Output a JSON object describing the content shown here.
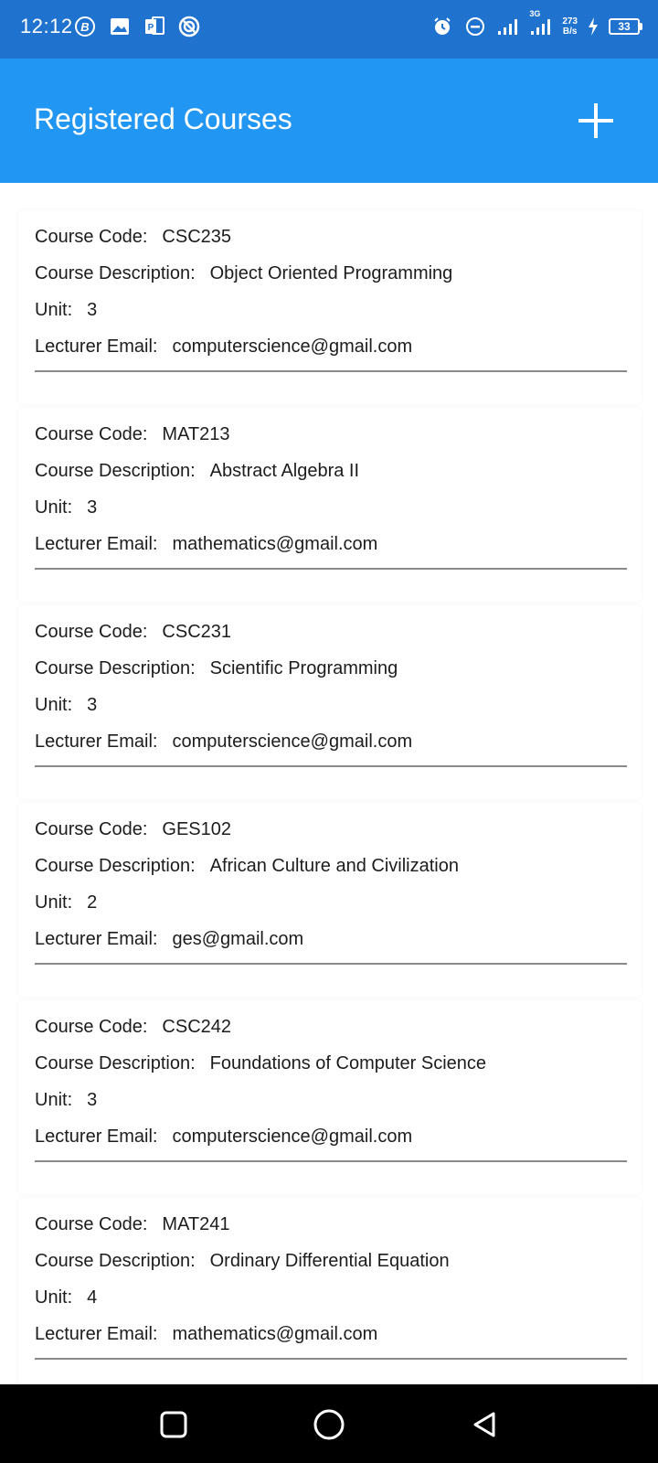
{
  "status_bar": {
    "time": "12:12",
    "net_speed_value": "273",
    "net_speed_unit": "B/s",
    "network_type": "3G",
    "battery": "33"
  },
  "app_bar": {
    "title": "Registered Courses"
  },
  "labels": {
    "code": "Course Code:",
    "description": "Course Description:",
    "unit": "Unit:",
    "email": "Lecturer Email:"
  },
  "courses": [
    {
      "code": "CSC235",
      "description": "Object Oriented Programming",
      "unit": "3",
      "email": "computerscience@gmail.com"
    },
    {
      "code": "MAT213",
      "description": "Abstract Algebra II",
      "unit": "3",
      "email": "mathematics@gmail.com"
    },
    {
      "code": "CSC231",
      "description": "Scientific Programming",
      "unit": "3",
      "email": "computerscience@gmail.com"
    },
    {
      "code": "GES102",
      "description": "African Culture and Civilization",
      "unit": "2",
      "email": "ges@gmail.com"
    },
    {
      "code": "CSC242",
      "description": "Foundations of Computer Science",
      "unit": "3",
      "email": "computerscience@gmail.com"
    },
    {
      "code": "MAT241",
      "description": "Ordinary Differential Equation",
      "unit": "4",
      "email": "mathematics@gmail.com"
    }
  ],
  "icons": {
    "add": "plus-icon",
    "nav_recents": "square-icon",
    "nav_home": "circle-icon",
    "nav_back": "triangle-back-icon"
  },
  "colors": {
    "status_bar": "#1f73cf",
    "app_bar": "#2196f3",
    "nav_bar": "#000000"
  }
}
